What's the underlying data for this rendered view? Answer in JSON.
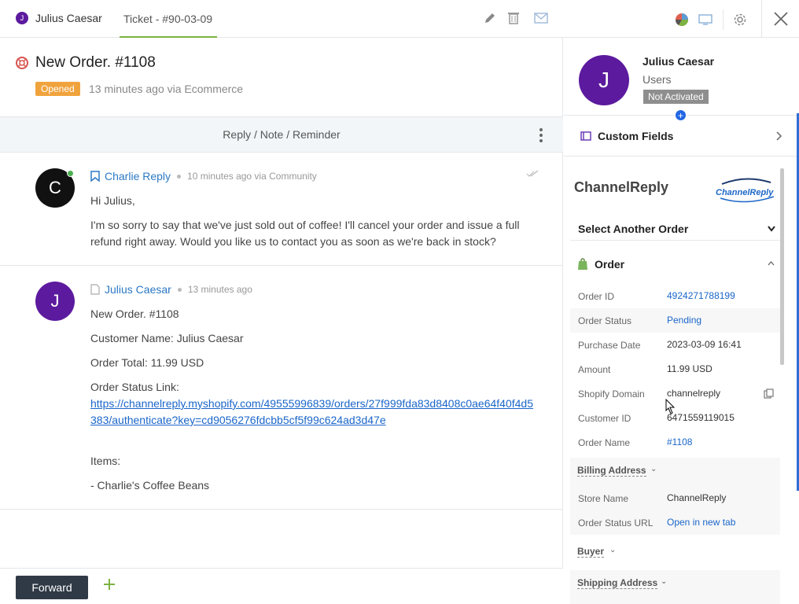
{
  "topbar": {
    "user_tab": "Julius Caesar",
    "user_initial": "J",
    "ticket_tab": "Ticket - #90-03-09"
  },
  "ticket": {
    "title": "New Order. #1108",
    "status": "Opened",
    "meta": "13 minutes ago via Ecommerce",
    "reply_bar": "Reply / Note / Reminder"
  },
  "messages": [
    {
      "initial": "C",
      "author": "Charlie Reply",
      "time": "10 minutes ago via Community",
      "lines": [
        "Hi Julius,",
        "I'm so sorry to say that we've just sold out of coffee! I'll cancel your order and issue a full refund right away. Would you like us to contact you as soon as we're back in stock?"
      ]
    },
    {
      "initial": "J",
      "author": "Julius Caesar",
      "time": "13 minutes ago",
      "lines": [
        "New Order. #1108",
        "Customer Name: Julius Caesar",
        "Order Total: 11.99 USD",
        "Order Status Link:"
      ],
      "link": "https://channelreply.myshopify.com/49555996839/orders/27f999fda83d8408c0ae64f40f4d5383/authenticate?key=cd9056276fdcbb5cf5f99c624ad3d47e",
      "items_label": "Items:",
      "item": "- Charlie's Coffee Beans"
    }
  ],
  "footer": {
    "forward_label": "Forward"
  },
  "sidebar": {
    "initial": "J",
    "name": "Julius Caesar",
    "role": "Users",
    "badge": "Not Activated",
    "custom_fields": "Custom Fields",
    "channelreply_title": "ChannelReply",
    "logo_text": "ChannelReply",
    "select_order": "Select Another Order",
    "order_section": "Order",
    "fields": [
      {
        "k": "Order ID",
        "v": "4924271788199"
      },
      {
        "k": "Order Status",
        "v": "Pending"
      },
      {
        "k": "Purchase Date",
        "v": "2023-03-09 16:41"
      },
      {
        "k": "Amount",
        "v": "11.99 USD"
      },
      {
        "k": "Shopify Domain",
        "v": "channelreply"
      },
      {
        "k": "Customer ID",
        "v": "6471559119015"
      },
      {
        "k": "Order Name",
        "v": "#1108"
      }
    ],
    "billing_label": "Billing Address",
    "store_fields": [
      {
        "k": "Store Name",
        "v": "ChannelReply"
      },
      {
        "k": "Order Status URL",
        "v": "Open in new tab"
      }
    ],
    "buyer_label": "Buyer",
    "shipping_label": "Shipping Address"
  },
  "colors": {
    "accent_green": "#7cb342",
    "status_orange": "#f0a33d",
    "link_blue": "#1a66c9",
    "avatar_purple": "#5c1a9e"
  }
}
